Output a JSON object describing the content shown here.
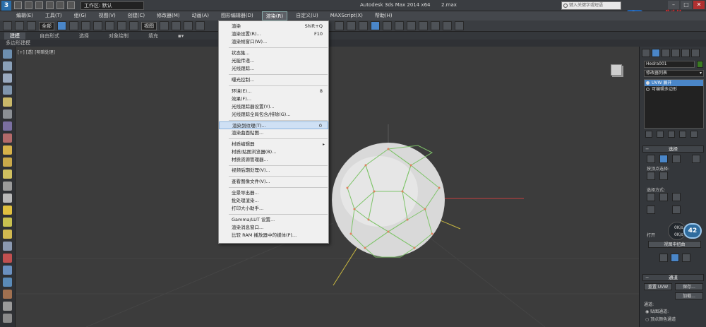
{
  "titlebar": {
    "logo": "3",
    "workspace": "工作区: 默认",
    "app_title": "Autodesk 3ds Max  2014 x64",
    "file_name": "2.max",
    "search_placeholder": "键入关键字或短语"
  },
  "watermark": {
    "stars": "***",
    "text": "制作"
  },
  "menubar": {
    "items": [
      "编辑(E)",
      "工具(T)",
      "组(G)",
      "视图(V)",
      "创建(C)",
      "修改器(M)",
      "动画(A)",
      "图形编辑器(D)",
      "渲染(R)",
      "自定义(U)",
      "MAXScript(X)",
      "帮助(H)"
    ],
    "active_index": 8
  },
  "toolbar": {
    "selection_filter": "全部",
    "coord_system": "视图"
  },
  "ribbon": {
    "tabs": [
      "建模",
      "自由形式",
      "选择",
      "对象绘制",
      "填充"
    ],
    "sub_label": "多边形建模"
  },
  "viewport": {
    "label": "[+] [透] [明暗处理]"
  },
  "render_menu": {
    "items": [
      {
        "label": "渲染",
        "shortcut": "Shift+Q"
      },
      {
        "label": "渲染设置(R)...",
        "shortcut": "F10"
      },
      {
        "label": "渲染帧窗口(W)...",
        "shortcut": ""
      },
      {
        "label": "状态集...",
        "shortcut": ""
      },
      {
        "label": "光能传递...",
        "shortcut": ""
      },
      {
        "label": "光线跟踪...",
        "shortcut": ""
      },
      {
        "label": "曝光控制...",
        "shortcut": ""
      },
      {
        "label": "环境(E)...",
        "shortcut": "8"
      },
      {
        "label": "效果(F)...",
        "shortcut": ""
      },
      {
        "label": "光线跟踪器设置(Y)...",
        "shortcut": ""
      },
      {
        "label": "光线跟踪全局包含/排除(G)...",
        "shortcut": ""
      },
      {
        "label": "渲染到纹理(T)...",
        "shortcut": "0"
      },
      {
        "label": "渲染曲面贴图...",
        "shortcut": ""
      },
      {
        "label": "材质编辑器",
        "shortcut": ""
      },
      {
        "label": "材质/贴图浏览器(B)...",
        "shortcut": ""
      },
      {
        "label": "材质资源管理器...",
        "shortcut": ""
      },
      {
        "label": "视频后期处理(V)...",
        "shortcut": ""
      },
      {
        "label": "查看图像文件(V)...",
        "shortcut": ""
      },
      {
        "label": "全景导出器...",
        "shortcut": ""
      },
      {
        "label": "批处理渲染...",
        "shortcut": ""
      },
      {
        "label": "打印大小助手...",
        "shortcut": ""
      },
      {
        "label": "Gamma/LUT 设置...",
        "shortcut": ""
      },
      {
        "label": "渲染消息窗口...",
        "shortcut": ""
      },
      {
        "label": "比较 RAM 播放器中的媒体(P)...",
        "shortcut": ""
      }
    ],
    "highlight_index": 11,
    "submenu_index": 13
  },
  "command_panel": {
    "object_name": "Hedra001",
    "modifier_list": "修改器列表",
    "stack": [
      "UVW 展开",
      "可编辑多边形"
    ],
    "selection_rollout": "选择",
    "vertex_select_label": "按顶点选择:",
    "select_by_label": "选择方式:",
    "open_label": "打开",
    "view_center": "视图中扭曲",
    "channel_rollout": "通道",
    "reset_uvw": "重置 UVW",
    "save": "保存...",
    "load": "加载...",
    "channel_label": "通道:",
    "map_channel": "贴图通道:",
    "vertex_color": "顶点颜色通道"
  },
  "status": {
    "fps": "42",
    "speed_up": "0K/s",
    "speed_down": "0K/s"
  }
}
